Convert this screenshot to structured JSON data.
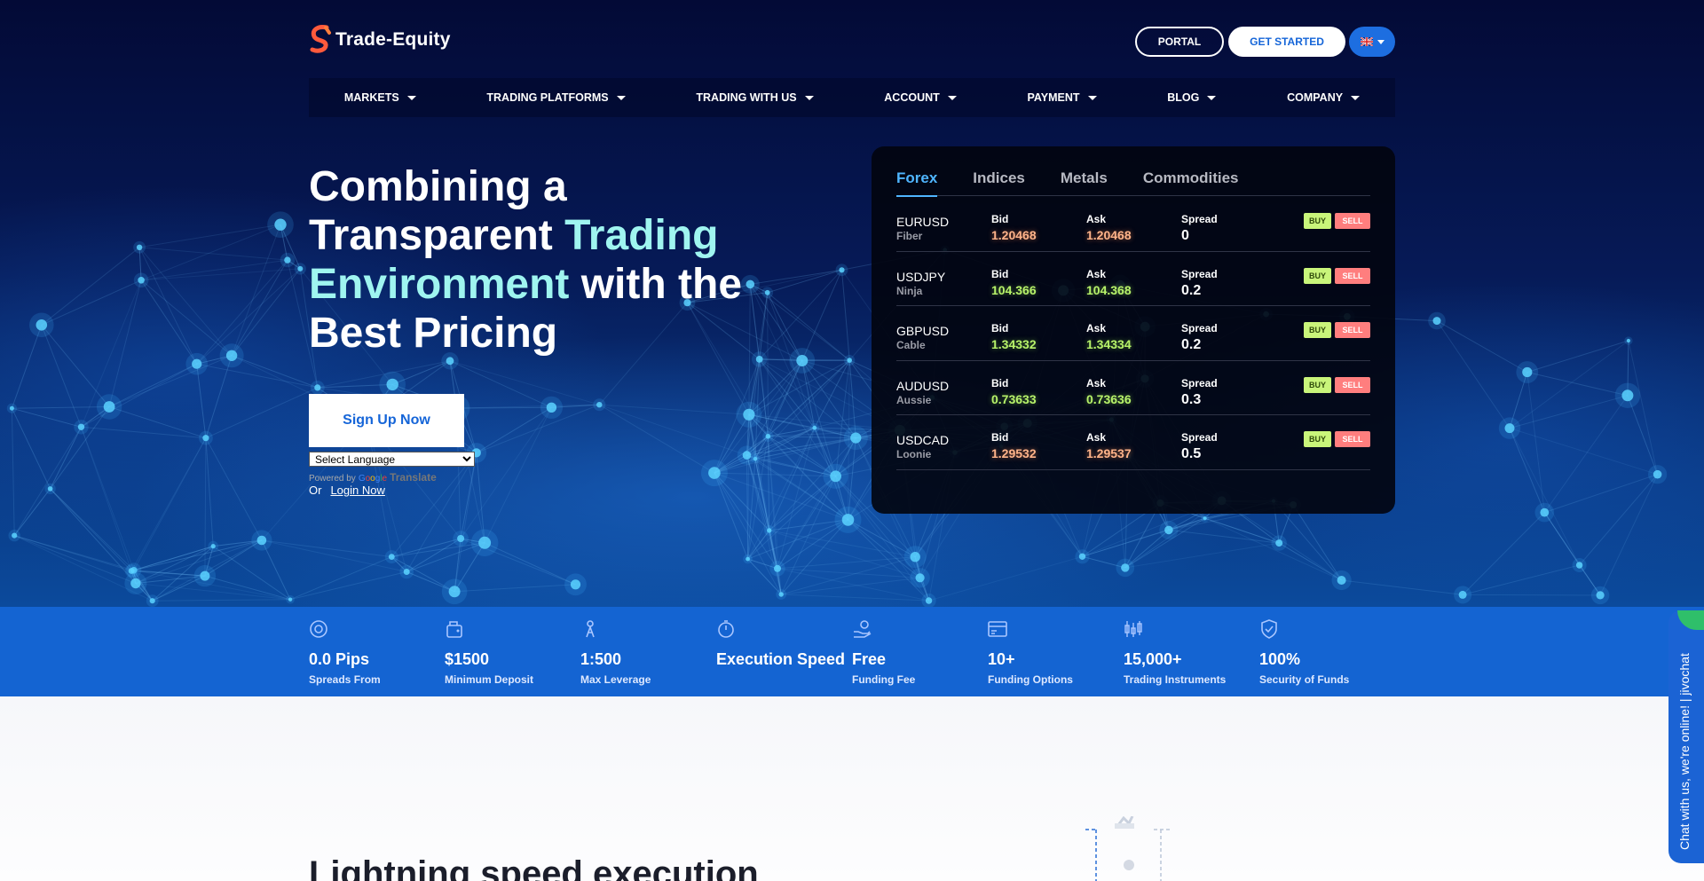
{
  "brand": {
    "name": "Trade-Equity"
  },
  "header": {
    "portal_label": "PORTAL",
    "get_started_label": "GET STARTED"
  },
  "nav": {
    "items": [
      {
        "label": "MARKETS"
      },
      {
        "label": "TRADING PLATFORMS"
      },
      {
        "label": "TRADING WITH US"
      },
      {
        "label": "ACCOUNT"
      },
      {
        "label": "PAYMENT"
      },
      {
        "label": "BLOG"
      },
      {
        "label": "COMPANY"
      }
    ]
  },
  "hero": {
    "headline_1": "Combining a",
    "headline_2": "Transparent",
    "headline_highlight": "Trading Environment",
    "headline_3": "with the Best Pricing",
    "signup_label": "Sign Up Now",
    "language_select": "Select Language",
    "powered_by": "Powered by",
    "google": "Google",
    "translate": "Translate",
    "or": "Or",
    "login_label": "Login Now"
  },
  "quotes": {
    "tabs": [
      "Forex",
      "Indices",
      "Metals",
      "Commodities"
    ],
    "active_tab": "Forex",
    "bid_label": "Bid",
    "ask_label": "Ask",
    "spread_label": "Spread",
    "buy_label": "BUY",
    "sell_label": "SELL",
    "rows": [
      {
        "symbol": "EURUSD",
        "nickname": "Fiber",
        "bid": "1.20468",
        "ask": "1.20468",
        "spread": "0",
        "trend": "down"
      },
      {
        "symbol": "USDJPY",
        "nickname": "Ninja",
        "bid": "104.366",
        "ask": "104.368",
        "spread": "0.2",
        "trend": "up"
      },
      {
        "symbol": "GBPUSD",
        "nickname": "Cable",
        "bid": "1.34332",
        "ask": "1.34334",
        "spread": "0.2",
        "trend": "up"
      },
      {
        "symbol": "AUDUSD",
        "nickname": "Aussie",
        "bid": "0.73633",
        "ask": "0.73636",
        "spread": "0.3",
        "trend": "up"
      },
      {
        "symbol": "USDCAD",
        "nickname": "Loonie",
        "bid": "1.29532",
        "ask": "1.29537",
        "spread": "0.5",
        "trend": "down"
      }
    ]
  },
  "stats": [
    {
      "value": "0.0 Pips",
      "label": "Spreads From",
      "icon": "target-icon"
    },
    {
      "value": "$1500",
      "label": "Minimum Deposit",
      "icon": "wallet-icon"
    },
    {
      "value": "1:500",
      "label": "Max Leverage",
      "icon": "leverage-icon"
    },
    {
      "value": "Execution Speed",
      "label": "",
      "icon": "stopwatch-icon"
    },
    {
      "value": "Free",
      "label": "Funding Fee",
      "icon": "hand-coin-icon"
    },
    {
      "value": "10+",
      "label": "Funding Options",
      "icon": "card-icon"
    },
    {
      "value": "15,000+",
      "label": "Trading Instruments",
      "icon": "candles-icon"
    },
    {
      "value": "100%",
      "label": "Security of Funds",
      "icon": "shield-check-icon"
    }
  ],
  "lower": {
    "title": "Lightning speed execution"
  },
  "chat": {
    "label": "Chat with us, we're online! | jivochat"
  },
  "colors": {
    "accent": "#1464d2",
    "highlight": "#9ff5f0",
    "tab_active": "#4fb5ff",
    "buy": "#c9f57a",
    "sell": "#ff7e7e",
    "price_down": "#ffb48a",
    "price_up": "#b7f26a"
  }
}
